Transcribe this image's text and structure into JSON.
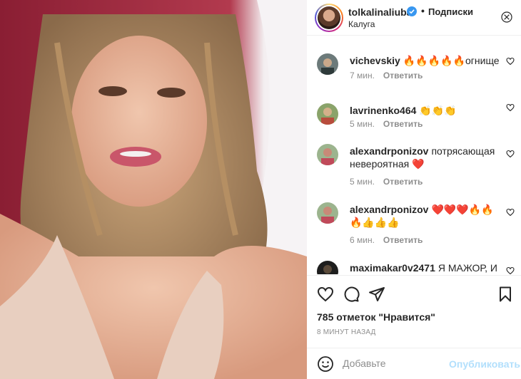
{
  "post": {
    "username": "tolkalinaliuba",
    "separator": "•",
    "follow_label": "Подписки",
    "location": "Калуга",
    "likes": "785 отметок \"Нравится\"",
    "time_ago": "8 МИНУТ НАЗАД"
  },
  "comments": [
    {
      "user": "vichevskiy",
      "text": "🔥🔥🔥🔥🔥огнище",
      "time": "7 мин.",
      "reply": "Ответить"
    },
    {
      "user": "lavrinenko464",
      "text": "👏👏👏",
      "time": "5 мин.",
      "reply": "Ответить"
    },
    {
      "user": "alexandrponizov",
      "text": "потрясающая невероятная ❤️",
      "time": "5 мин.",
      "reply": "Ответить"
    },
    {
      "user": "alexandrponizov",
      "text": "❤️❤️❤️🔥🔥🔥👍👍👍",
      "time": "6 мин.",
      "reply": "Ответить"
    },
    {
      "user": "maximakar0v2471",
      "text": "Я МАЖОР, И"
    }
  ],
  "add_comment": {
    "placeholder": "Добавьте",
    "publish_label": "Опубликовать"
  },
  "icons": {
    "like": "heart-icon",
    "comment": "comment-icon",
    "share": "paper-plane-icon",
    "save": "bookmark-icon",
    "more": "more-dots-icon",
    "emoji": "smiley-icon",
    "verified": "verified-badge-icon"
  },
  "colors": {
    "verified": "#3897f0",
    "publish_disabled": "#b2dffc",
    "muted": "#8e8e8e"
  }
}
